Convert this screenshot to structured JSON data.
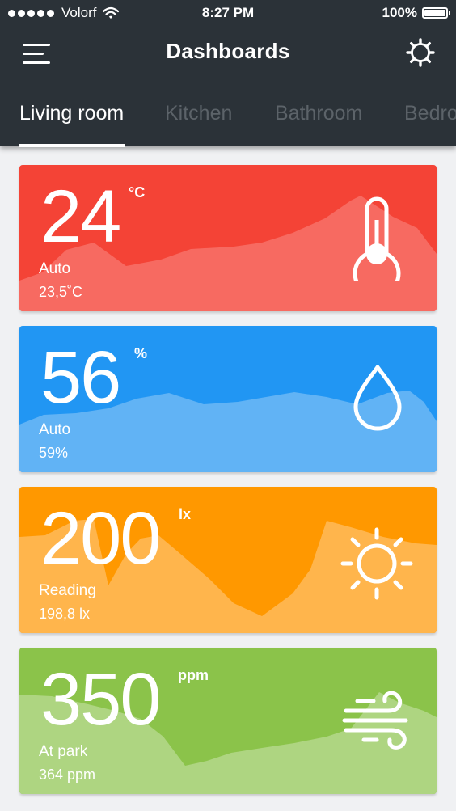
{
  "status_bar": {
    "carrier": "Volorf",
    "time": "8:27 PM",
    "battery": "100%"
  },
  "header": {
    "title": "Dashboards",
    "menu_icon": "hamburger-menu-icon",
    "settings_icon": "gear-icon"
  },
  "tabs": [
    {
      "label": "Living room",
      "active": true
    },
    {
      "label": "Kitchen",
      "active": false
    },
    {
      "label": "Bathroom",
      "active": false
    },
    {
      "label": "Bedroom",
      "active": false
    }
  ],
  "cards": [
    {
      "type": "temperature",
      "value": "24",
      "unit": "°C",
      "mode": "Auto",
      "reading": "23,5˚C",
      "color": "#f44336",
      "wave_color": "#f76a61",
      "icon": "thermometer-icon"
    },
    {
      "type": "humidity",
      "value": "56",
      "unit": "%",
      "mode": "Auto",
      "reading": "59%",
      "color": "#2196f3",
      "wave_color": "#61b3f5",
      "icon": "water-drop-icon"
    },
    {
      "type": "light",
      "value": "200",
      "unit": "lx",
      "mode": "Reading",
      "reading": "198,8 lx",
      "color": "#ff9800",
      "wave_color": "#ffb54c",
      "icon": "sun-icon"
    },
    {
      "type": "air_quality",
      "value": "350",
      "unit": "ppm",
      "mode": "At park",
      "reading": "364 ppm",
      "color": "#8bc34a",
      "wave_color": "#aed581",
      "icon": "wind-icon"
    }
  ]
}
